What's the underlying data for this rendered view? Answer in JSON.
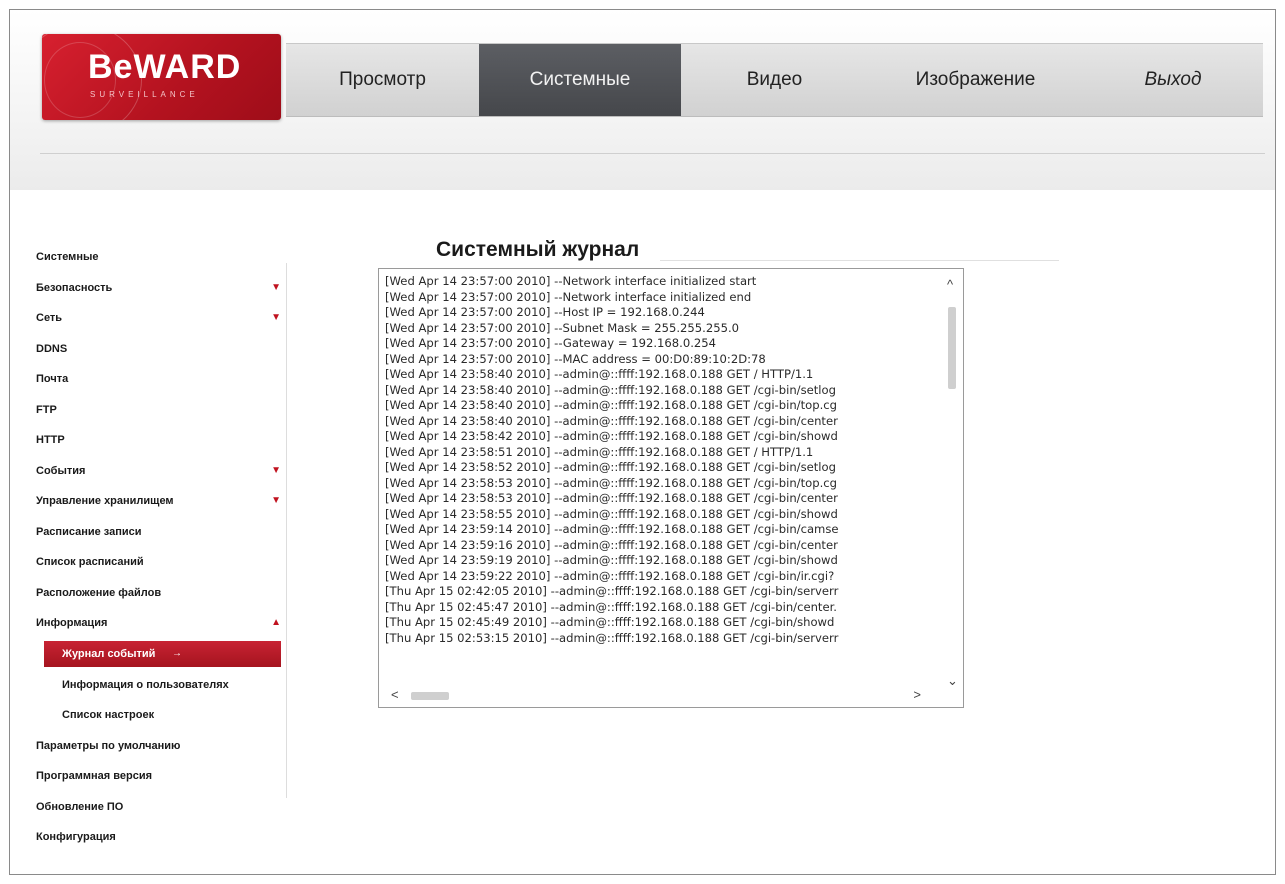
{
  "logo": {
    "brand": "BeWARD",
    "tagline": "SURVEILLANCE"
  },
  "nav": {
    "items": [
      {
        "label": "Просмотр",
        "active": false
      },
      {
        "label": "Системные",
        "active": true
      },
      {
        "label": "Видео",
        "active": false
      },
      {
        "label": "Изображение",
        "active": false
      },
      {
        "label": "Выход",
        "active": false
      }
    ]
  },
  "sidebar": {
    "items": [
      {
        "label": "Системные",
        "arrow": ""
      },
      {
        "label": "Безопасность",
        "arrow": "▼"
      },
      {
        "label": "Сеть",
        "arrow": "▼"
      },
      {
        "label": "DDNS",
        "arrow": ""
      },
      {
        "label": "Почта",
        "arrow": ""
      },
      {
        "label": "FTP",
        "arrow": ""
      },
      {
        "label": "HTTP",
        "arrow": ""
      },
      {
        "label": "События",
        "arrow": "▼"
      },
      {
        "label": "Управление хранилищем",
        "arrow": "▼"
      },
      {
        "label": "Расписание записи",
        "arrow": ""
      },
      {
        "label": "Список расписаний",
        "arrow": ""
      },
      {
        "label": "Расположение файлов",
        "arrow": ""
      },
      {
        "label": "Информация",
        "arrow": "▲"
      },
      {
        "label": "Журнал событий",
        "arrow": "→"
      },
      {
        "label": "Информация о пользователях",
        "arrow": ""
      },
      {
        "label": "Список настроек",
        "arrow": ""
      },
      {
        "label": "Параметры по умолчанию",
        "arrow": ""
      },
      {
        "label": "Программная версия",
        "arrow": ""
      },
      {
        "label": "Обновление ПО",
        "arrow": ""
      },
      {
        "label": "Конфигурация",
        "arrow": ""
      }
    ]
  },
  "main": {
    "title": "Системный журнал",
    "log_lines": [
      "[Wed Apr 14 23:57:00 2010] --Network interface initialized start",
      "[Wed Apr 14 23:57:00 2010] --Network interface initialized end",
      "[Wed Apr 14 23:57:00 2010] --Host IP = 192.168.0.244",
      "[Wed Apr 14 23:57:00 2010] --Subnet Mask = 255.255.255.0",
      "[Wed Apr 14 23:57:00 2010] --Gateway = 192.168.0.254",
      "[Wed Apr 14 23:57:00 2010] --MAC address = 00:D0:89:10:2D:78",
      "[Wed Apr 14 23:58:40 2010] --admin@::ffff:192.168.0.188 GET / HTTP/1.1",
      "[Wed Apr 14 23:58:40 2010] --admin@::ffff:192.168.0.188 GET /cgi-bin/setlog",
      "[Wed Apr 14 23:58:40 2010] --admin@::ffff:192.168.0.188 GET /cgi-bin/top.cg",
      "[Wed Apr 14 23:58:40 2010] --admin@::ffff:192.168.0.188 GET /cgi-bin/center",
      "[Wed Apr 14 23:58:42 2010] --admin@::ffff:192.168.0.188 GET /cgi-bin/showd",
      "[Wed Apr 14 23:58:51 2010] --admin@::ffff:192.168.0.188 GET / HTTP/1.1",
      "[Wed Apr 14 23:58:52 2010] --admin@::ffff:192.168.0.188 GET /cgi-bin/setlog",
      "[Wed Apr 14 23:58:53 2010] --admin@::ffff:192.168.0.188 GET /cgi-bin/top.cg",
      "[Wed Apr 14 23:58:53 2010] --admin@::ffff:192.168.0.188 GET /cgi-bin/center",
      "[Wed Apr 14 23:58:55 2010] --admin@::ffff:192.168.0.188 GET /cgi-bin/showd",
      "[Wed Apr 14 23:59:14 2010] --admin@::ffff:192.168.0.188 GET /cgi-bin/camse",
      "[Wed Apr 14 23:59:16 2010] --admin@::ffff:192.168.0.188 GET /cgi-bin/center",
      "[Wed Apr 14 23:59:19 2010] --admin@::ffff:192.168.0.188 GET /cgi-bin/showd",
      "[Wed Apr 14 23:59:22 2010] --admin@::ffff:192.168.0.188 GET /cgi-bin/ir.cgi?",
      "[Thu Apr 15 02:42:05 2010] --admin@::ffff:192.168.0.188 GET /cgi-bin/serverr",
      "[Thu Apr 15 02:45:47 2010] --admin@::ffff:192.168.0.188 GET /cgi-bin/center.",
      "[Thu Apr 15 02:45:49 2010] --admin@::ffff:192.168.0.188 GET /cgi-bin/showd",
      "[Thu Apr 15 02:53:15 2010] --admin@::ffff:192.168.0.188 GET /cgi-bin/serverr"
    ]
  },
  "icons": {
    "scroll_up": "^",
    "scroll_down": "⌄",
    "scroll_left": "<",
    "scroll_right": ">"
  },
  "colors": {
    "brand_red": "#c8202f",
    "active_tab": "#4f5155"
  }
}
